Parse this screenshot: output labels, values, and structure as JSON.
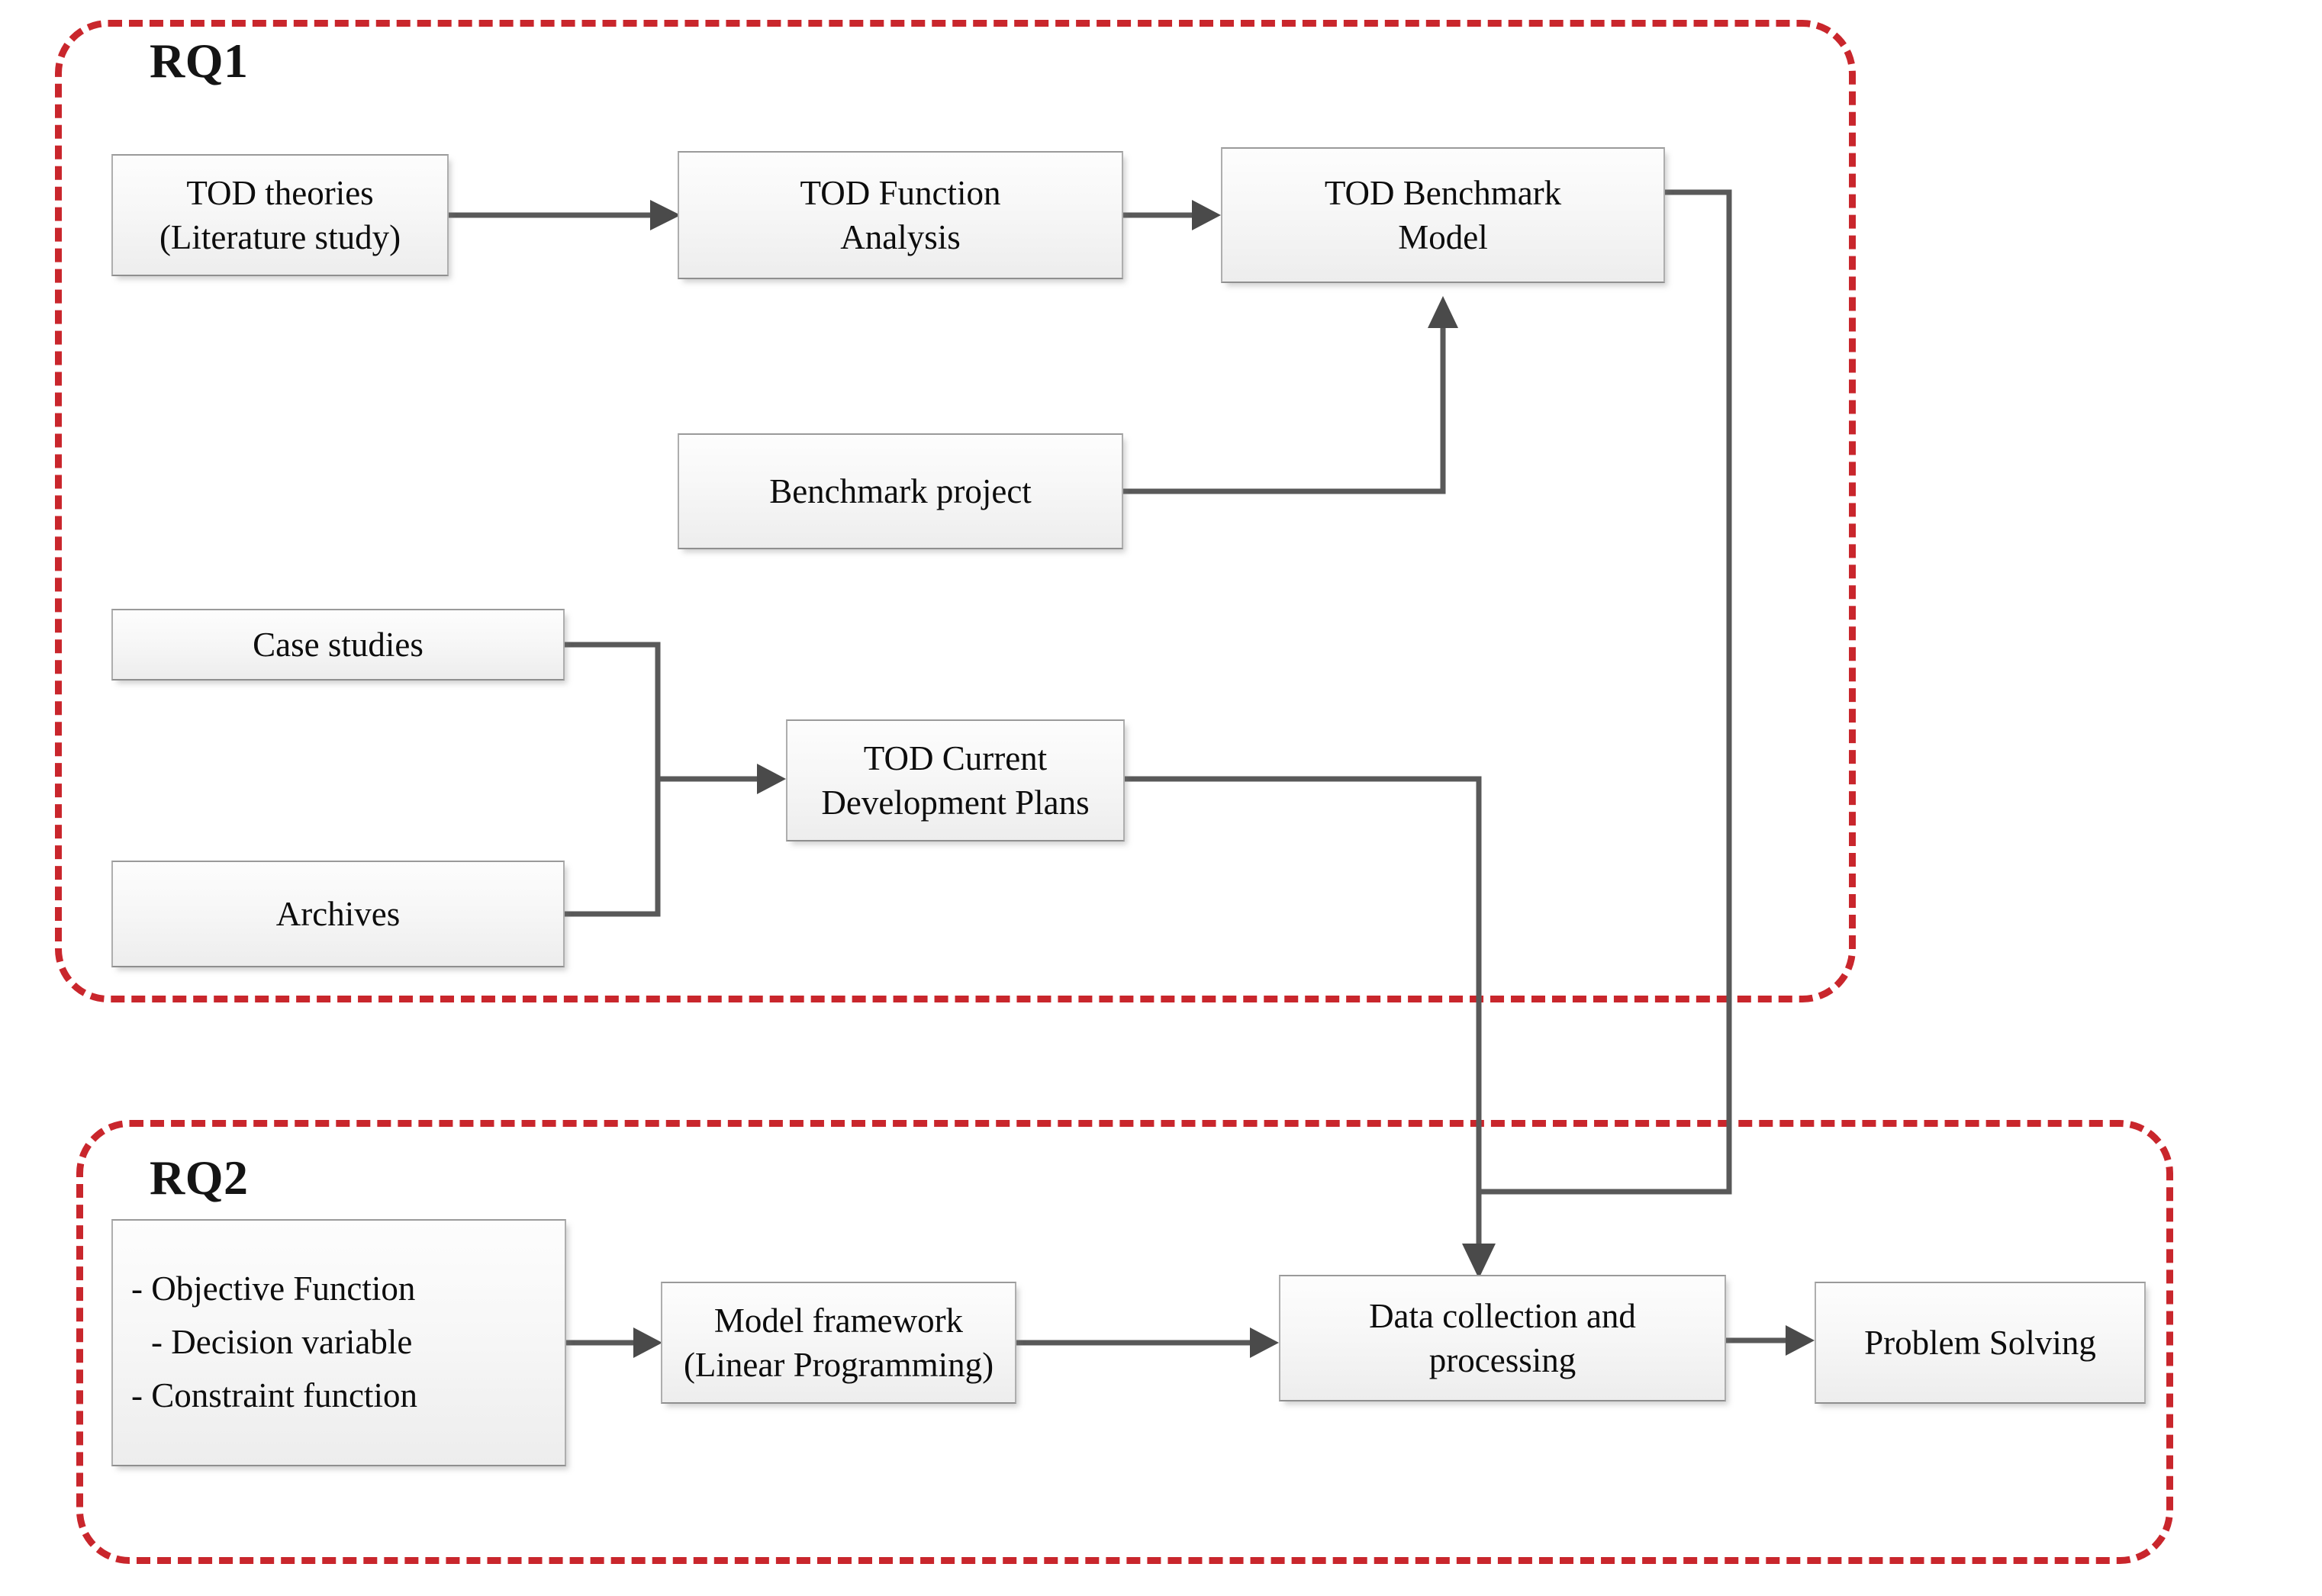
{
  "figure": {
    "title": "Research methodology flowchart",
    "accent_red": "#c9262c",
    "box_border": "#aeaeae",
    "connector_gray": "#595959",
    "arrowhead_gray": "#4a4a4a"
  },
  "regions": [
    {
      "id": "rq1",
      "label": "RQ1"
    },
    {
      "id": "rq2",
      "label": "RQ2"
    }
  ],
  "nodes": {
    "tod_theories": {
      "line1": "TOD theories",
      "line2": "(Literature study)"
    },
    "tod_function": {
      "line1": "TOD Function",
      "line2": "Analysis"
    },
    "tod_benchmark": {
      "line1": "TOD Benchmark",
      "line2": "Model"
    },
    "benchmark_project": {
      "line1": "Benchmark project"
    },
    "case_studies": {
      "line1": "Case studies"
    },
    "tod_current_plans": {
      "line1": "TOD Current",
      "line2": "Development Plans"
    },
    "archives": {
      "line1": "Archives"
    },
    "rq2_inputs": {
      "line1": "- Objective Function",
      "line2": "- Decision variable",
      "line3": "- Constraint function"
    },
    "model_framework": {
      "line1": "Model framework",
      "line2": "(Linear Programming)"
    },
    "data_collection": {
      "line1": "Data collection and",
      "line2": "processing"
    },
    "problem_solving": {
      "line1": "Problem Solving"
    }
  },
  "edges": [
    {
      "from": "tod_theories",
      "to": "tod_function",
      "style": "straight-right"
    },
    {
      "from": "tod_function",
      "to": "tod_benchmark",
      "style": "straight-right"
    },
    {
      "from": "benchmark_project",
      "to": "tod_benchmark",
      "style": "right-then-up"
    },
    {
      "from": "case_studies",
      "to": "tod_current_plans",
      "style": "merge-right"
    },
    {
      "from": "archives",
      "to": "tod_current_plans",
      "style": "merge-right"
    },
    {
      "from": "tod_benchmark",
      "to": "data_collection",
      "style": "right-down-left-down"
    },
    {
      "from": "tod_current_plans",
      "to": "data_collection",
      "style": "right-down"
    },
    {
      "from": "rq2_inputs",
      "to": "model_framework",
      "style": "straight-right"
    },
    {
      "from": "model_framework",
      "to": "data_collection",
      "style": "straight-right"
    },
    {
      "from": "data_collection",
      "to": "problem_solving",
      "style": "straight-right"
    }
  ]
}
